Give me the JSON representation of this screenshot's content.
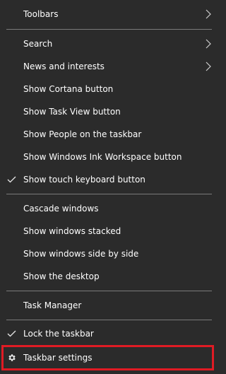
{
  "menu": {
    "items": {
      "toolbars": {
        "label": "Toolbars"
      },
      "search": {
        "label": "Search"
      },
      "news": {
        "label": "News and interests"
      },
      "cortana": {
        "label": "Show Cortana button"
      },
      "taskview": {
        "label": "Show Task View button"
      },
      "people": {
        "label": "Show People on the taskbar"
      },
      "ink": {
        "label": "Show Windows Ink Workspace button"
      },
      "touch": {
        "label": "Show touch keyboard button",
        "checked": true
      },
      "cascade": {
        "label": "Cascade windows"
      },
      "stacked": {
        "label": "Show windows stacked"
      },
      "sidebyside": {
        "label": "Show windows side by side"
      },
      "desktop": {
        "label": "Show the desktop"
      },
      "taskmanager": {
        "label": "Task Manager"
      },
      "lock": {
        "label": "Lock the taskbar",
        "checked": true
      },
      "settings": {
        "label": "Taskbar settings",
        "icon": "gear-icon"
      }
    },
    "colors": {
      "background": "#2b2b2b",
      "text": "#ffffff",
      "divider": "#7a7a7a",
      "highlight_border": "#e01b24"
    }
  }
}
